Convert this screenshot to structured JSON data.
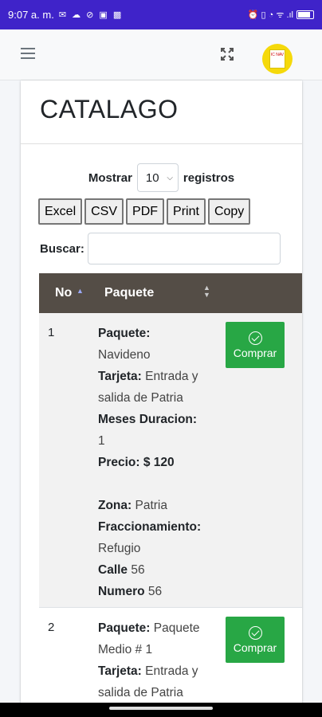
{
  "status": {
    "time": "9:07 a. m.",
    "left_icons": "✉ ☁ ⊘ ▣ ▩",
    "right_icons": "⏰ ▯ ◔ ᯤ .ıl"
  },
  "navbar": {
    "menu_icon": "hamburger-icon",
    "fullscreen_icon": "expand-icon",
    "avatar_text": "IC NAV"
  },
  "page": {
    "title": "CATALAGO"
  },
  "length": {
    "label_before": "Mostrar",
    "value": "10",
    "label_after": "registros"
  },
  "export_buttons": [
    "Excel",
    "CSV",
    "PDF",
    "Print",
    "Copy"
  ],
  "search": {
    "label": "Buscar:",
    "value": ""
  },
  "table": {
    "columns": [
      "No",
      "Paquete"
    ],
    "rows": [
      {
        "no": "1",
        "paquete_label": "Paquete:",
        "paquete": "Navideno",
        "tarjeta_label": "Tarjeta:",
        "tarjeta": "Entrada y salida de Patria",
        "meses_label": "Meses Duracion:",
        "meses": "1",
        "precio_label": "Precio:",
        "precio": "$ 120",
        "zona_label": "Zona:",
        "zona": "Patria",
        "fracc_label": "Fraccionamiento:",
        "fracc": "Refugio",
        "calle_label": "Calle",
        "calle": "56",
        "numero_label": "Numero",
        "numero": "56",
        "button": "Comprar"
      },
      {
        "no": "2",
        "paquete_label": "Paquete:",
        "paquete": "Paquete Medio # 1",
        "tarjeta_label": "Tarjeta:",
        "tarjeta": "Entrada y salida de Patria",
        "button": "Comprar"
      }
    ]
  },
  "colors": {
    "status_bar": "#3f23c9",
    "table_header": "#544d46",
    "comprar": "#28a745"
  }
}
